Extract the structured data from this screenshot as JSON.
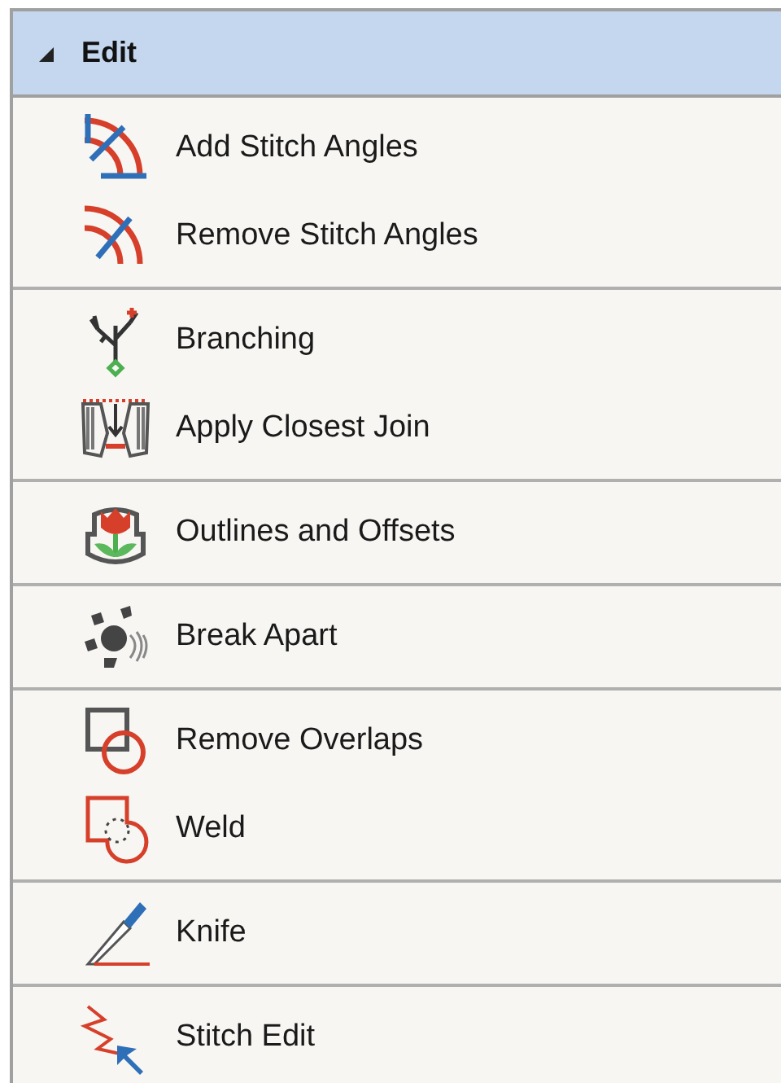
{
  "header": {
    "title": "Edit",
    "expanded": true
  },
  "groups": [
    {
      "items": [
        {
          "label": "Add Stitch Angles",
          "kind": "add-angles"
        },
        {
          "label": "Remove Stitch Angles",
          "kind": "remove-angles"
        }
      ]
    },
    {
      "items": [
        {
          "label": "Branching",
          "kind": "branching"
        },
        {
          "label": "Apply Closest Join",
          "kind": "closest-join"
        }
      ]
    },
    {
      "items": [
        {
          "label": "Outlines and Offsets",
          "kind": "outlines"
        }
      ]
    },
    {
      "items": [
        {
          "label": "Break Apart",
          "kind": "break-apart"
        }
      ]
    },
    {
      "items": [
        {
          "label": "Remove Overlaps",
          "kind": "overlaps"
        },
        {
          "label": "Weld",
          "kind": "weld"
        }
      ]
    },
    {
      "items": [
        {
          "label": "Knife",
          "kind": "knife"
        }
      ]
    },
    {
      "items": [
        {
          "label": "Stitch Edit",
          "kind": "stitch-edit"
        }
      ]
    }
  ]
}
